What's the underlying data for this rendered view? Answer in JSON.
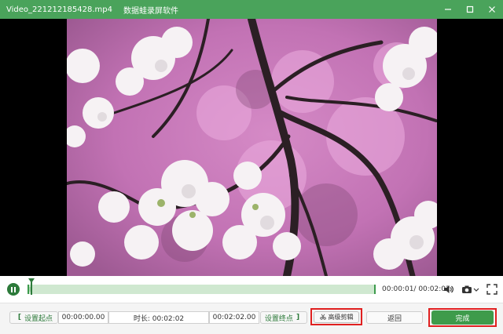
{
  "window": {
    "file_name": "Video_221212185428.mp4",
    "app_name": "数据蛙录屏软件"
  },
  "player": {
    "time_display": "00:00:01/ 00:02:02",
    "progress_fraction": 0.01
  },
  "trim": {
    "set_start_label": "设置起点",
    "start_time": "00:00:00.00",
    "duration_label": "时长: 00:02:02",
    "end_time": "00:02:02.00",
    "set_end_label": "设置终点",
    "start_bracket": "[",
    "end_bracket": "]"
  },
  "actions": {
    "advanced_edit_label": "高级剪辑",
    "back_label": "返回",
    "done_label": "完成"
  },
  "colors": {
    "accent": "#4aa35b",
    "primary_button": "#3e9b4b",
    "highlight_border": "#e02020"
  },
  "icons": [
    "minimize-icon",
    "maximize-icon",
    "close-icon",
    "pause-icon",
    "volume-icon",
    "camera-icon",
    "chevron-down-icon",
    "fullscreen-icon",
    "scissors-icon"
  ]
}
